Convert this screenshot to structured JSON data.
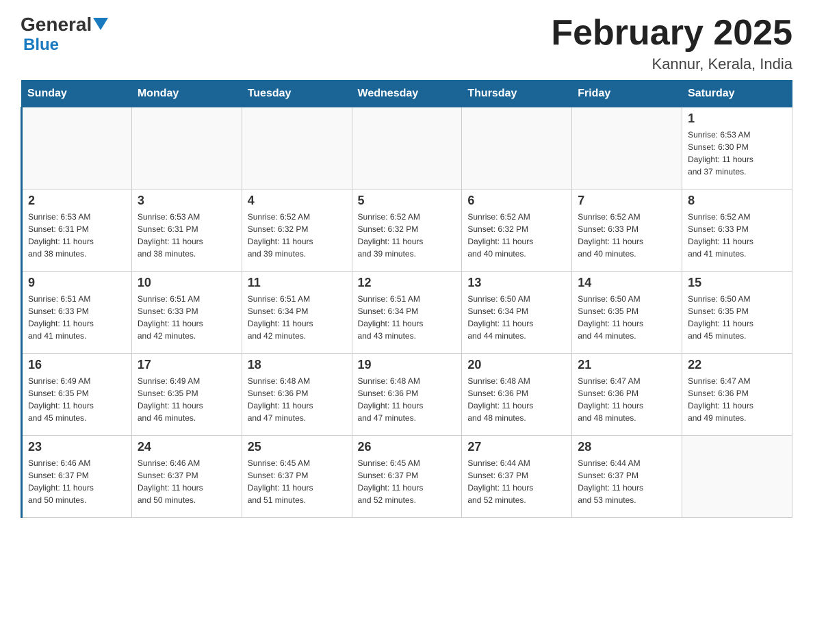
{
  "header": {
    "logo": {
      "general": "General",
      "blue": "Blue"
    },
    "title": "February 2025",
    "location": "Kannur, Kerala, India"
  },
  "calendar": {
    "days_of_week": [
      "Sunday",
      "Monday",
      "Tuesday",
      "Wednesday",
      "Thursday",
      "Friday",
      "Saturday"
    ],
    "weeks": [
      {
        "days": [
          {
            "number": "",
            "info": ""
          },
          {
            "number": "",
            "info": ""
          },
          {
            "number": "",
            "info": ""
          },
          {
            "number": "",
            "info": ""
          },
          {
            "number": "",
            "info": ""
          },
          {
            "number": "",
            "info": ""
          },
          {
            "number": "1",
            "info": "Sunrise: 6:53 AM\nSunset: 6:30 PM\nDaylight: 11 hours\nand 37 minutes."
          }
        ]
      },
      {
        "days": [
          {
            "number": "2",
            "info": "Sunrise: 6:53 AM\nSunset: 6:31 PM\nDaylight: 11 hours\nand 38 minutes."
          },
          {
            "number": "3",
            "info": "Sunrise: 6:53 AM\nSunset: 6:31 PM\nDaylight: 11 hours\nand 38 minutes."
          },
          {
            "number": "4",
            "info": "Sunrise: 6:52 AM\nSunset: 6:32 PM\nDaylight: 11 hours\nand 39 minutes."
          },
          {
            "number": "5",
            "info": "Sunrise: 6:52 AM\nSunset: 6:32 PM\nDaylight: 11 hours\nand 39 minutes."
          },
          {
            "number": "6",
            "info": "Sunrise: 6:52 AM\nSunset: 6:32 PM\nDaylight: 11 hours\nand 40 minutes."
          },
          {
            "number": "7",
            "info": "Sunrise: 6:52 AM\nSunset: 6:33 PM\nDaylight: 11 hours\nand 40 minutes."
          },
          {
            "number": "8",
            "info": "Sunrise: 6:52 AM\nSunset: 6:33 PM\nDaylight: 11 hours\nand 41 minutes."
          }
        ]
      },
      {
        "days": [
          {
            "number": "9",
            "info": "Sunrise: 6:51 AM\nSunset: 6:33 PM\nDaylight: 11 hours\nand 41 minutes."
          },
          {
            "number": "10",
            "info": "Sunrise: 6:51 AM\nSunset: 6:33 PM\nDaylight: 11 hours\nand 42 minutes."
          },
          {
            "number": "11",
            "info": "Sunrise: 6:51 AM\nSunset: 6:34 PM\nDaylight: 11 hours\nand 42 minutes."
          },
          {
            "number": "12",
            "info": "Sunrise: 6:51 AM\nSunset: 6:34 PM\nDaylight: 11 hours\nand 43 minutes."
          },
          {
            "number": "13",
            "info": "Sunrise: 6:50 AM\nSunset: 6:34 PM\nDaylight: 11 hours\nand 44 minutes."
          },
          {
            "number": "14",
            "info": "Sunrise: 6:50 AM\nSunset: 6:35 PM\nDaylight: 11 hours\nand 44 minutes."
          },
          {
            "number": "15",
            "info": "Sunrise: 6:50 AM\nSunset: 6:35 PM\nDaylight: 11 hours\nand 45 minutes."
          }
        ]
      },
      {
        "days": [
          {
            "number": "16",
            "info": "Sunrise: 6:49 AM\nSunset: 6:35 PM\nDaylight: 11 hours\nand 45 minutes."
          },
          {
            "number": "17",
            "info": "Sunrise: 6:49 AM\nSunset: 6:35 PM\nDaylight: 11 hours\nand 46 minutes."
          },
          {
            "number": "18",
            "info": "Sunrise: 6:48 AM\nSunset: 6:36 PM\nDaylight: 11 hours\nand 47 minutes."
          },
          {
            "number": "19",
            "info": "Sunrise: 6:48 AM\nSunset: 6:36 PM\nDaylight: 11 hours\nand 47 minutes."
          },
          {
            "number": "20",
            "info": "Sunrise: 6:48 AM\nSunset: 6:36 PM\nDaylight: 11 hours\nand 48 minutes."
          },
          {
            "number": "21",
            "info": "Sunrise: 6:47 AM\nSunset: 6:36 PM\nDaylight: 11 hours\nand 48 minutes."
          },
          {
            "number": "22",
            "info": "Sunrise: 6:47 AM\nSunset: 6:36 PM\nDaylight: 11 hours\nand 49 minutes."
          }
        ]
      },
      {
        "days": [
          {
            "number": "23",
            "info": "Sunrise: 6:46 AM\nSunset: 6:37 PM\nDaylight: 11 hours\nand 50 minutes."
          },
          {
            "number": "24",
            "info": "Sunrise: 6:46 AM\nSunset: 6:37 PM\nDaylight: 11 hours\nand 50 minutes."
          },
          {
            "number": "25",
            "info": "Sunrise: 6:45 AM\nSunset: 6:37 PM\nDaylight: 11 hours\nand 51 minutes."
          },
          {
            "number": "26",
            "info": "Sunrise: 6:45 AM\nSunset: 6:37 PM\nDaylight: 11 hours\nand 52 minutes."
          },
          {
            "number": "27",
            "info": "Sunrise: 6:44 AM\nSunset: 6:37 PM\nDaylight: 11 hours\nand 52 minutes."
          },
          {
            "number": "28",
            "info": "Sunrise: 6:44 AM\nSunset: 6:37 PM\nDaylight: 11 hours\nand 53 minutes."
          },
          {
            "number": "",
            "info": ""
          }
        ]
      }
    ]
  }
}
